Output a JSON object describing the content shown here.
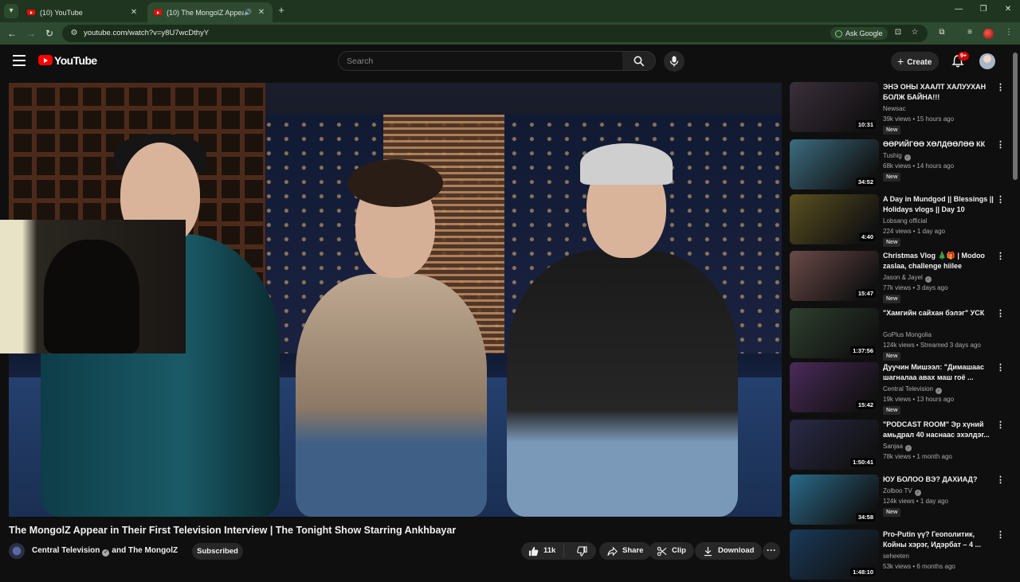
{
  "browser": {
    "tabs": [
      {
        "title": "(10) YouTube",
        "active": false
      },
      {
        "title": "(10) The MongolZ Appear",
        "active": true,
        "audio": true
      }
    ],
    "url": "youtube.com/watch?v=y8U7wcDthyY",
    "ask_google": "Ask Google"
  },
  "header": {
    "logo_text": "YouTube",
    "search_placeholder": "Search",
    "create_label": "Create",
    "notifications_badge": "9+"
  },
  "video": {
    "title": "The MongolZ Appear in Their First Television Interview | The Tonight Show Starring Ankhbayar",
    "channel": "Central Television",
    "collab": "and The MongolZ",
    "subscribed_label": "Subscribed",
    "likes": "11k",
    "share_label": "Share",
    "clip_label": "Clip",
    "download_label": "Download"
  },
  "sidebar": [
    {
      "title": "ЭНЭ ОНЫ ХААЛТ ХАЛУУХАН БОЛЖ БАЙНА!!!",
      "channel": "Newsac",
      "verified": false,
      "meta": "39k views • 15 hours ago",
      "badge": "New",
      "duration": "10:31",
      "thumb_color": "#3a2f3a"
    },
    {
      "title": "ӨӨРИЙГӨӨ ХӨЛДӨӨЛӨӨ КК",
      "channel": "Tushig",
      "verified": true,
      "meta": "68k views • 14 hours ago",
      "badge": "New",
      "duration": "34:52",
      "thumb_color": "#3c6c80"
    },
    {
      "title": "A Day in Mundgod || Blessings || Holidays vlogs || Day 10",
      "channel": "Lobsang official",
      "verified": false,
      "meta": "224 views • 1 day ago",
      "badge": "New",
      "duration": "4:40",
      "thumb_color": "#5a5020"
    },
    {
      "title": "Christmas Vlog 🎄🎁 | Modoo zaslaa, challenge hiilee",
      "channel": "Jason & Jayel",
      "verified": true,
      "meta": "77k views • 3 days ago",
      "badge": "New",
      "duration": "15:47",
      "thumb_color": "#6a4a48"
    },
    {
      "title": "\"Хамгийн сайхан бэлэг\" УСК",
      "channel": "GoPlus Mongolia",
      "verified": false,
      "meta": "124k views • Streamed 3 days ago",
      "badge": "New",
      "duration": "1:37:56",
      "thumb_color": "#2f3f2f"
    },
    {
      "title": "Дуучин Мишээл: \"Димашаас шагналаа авах маш гоё ...",
      "channel": "Central Television",
      "verified": true,
      "meta": "19k views • 13 hours ago",
      "badge": "New",
      "duration": "15:42",
      "thumb_color": "#4a2a5a"
    },
    {
      "title": "\"PODCAST ROOM\" Эр хүний амьдрал 40 наснаас эхэлдэг...",
      "channel": "Sanjaa",
      "verified": true,
      "meta": "78k views • 1 month ago",
      "badge": "",
      "duration": "1:50:41",
      "thumb_color": "#2a2a48"
    },
    {
      "title": "ЮУ БОЛОО ВЭ? ДАХИАД?",
      "channel": "Zolboo TV",
      "verified": true,
      "meta": "124k views • 1 day ago",
      "badge": "New",
      "duration": "34:58",
      "thumb_color": "#2a6a8a"
    },
    {
      "title": "Pro-Putin үү? Геополитик, Койны хэрэг, Идэрбат – 4 ...",
      "channel": "seheeten",
      "verified": false,
      "meta": "53k views • 6 months ago",
      "badge": "",
      "duration": "1:48:10",
      "thumb_color": "#1a3a5a"
    }
  ]
}
